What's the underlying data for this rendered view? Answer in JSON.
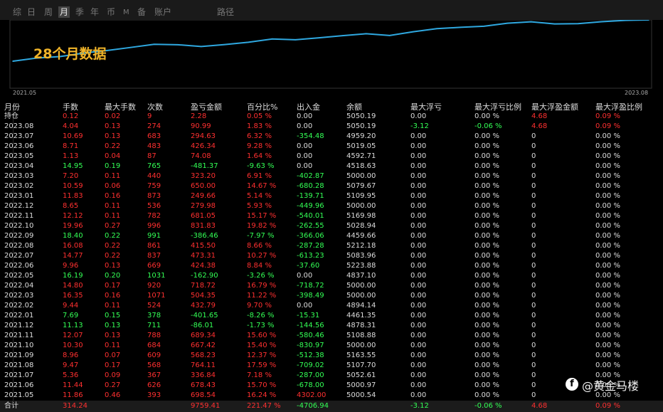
{
  "tabs": [
    {
      "label": "综",
      "active": false
    },
    {
      "label": "日",
      "active": false
    },
    {
      "label": "周",
      "active": false
    },
    {
      "label": "月",
      "active": true
    },
    {
      "label": "季",
      "active": false
    },
    {
      "label": "年",
      "active": false
    },
    {
      "label": "币",
      "active": false
    },
    {
      "label": "M",
      "active": false
    },
    {
      "label": "备",
      "active": false
    },
    {
      "label": "账户",
      "active": false
    },
    {
      "label": "路径",
      "active": false
    }
  ],
  "chart": {
    "title": "28个月数据",
    "x_start": "2021.05",
    "x_end": "2023.08"
  },
  "chart_data": {
    "type": "line",
    "title": "28个月数据",
    "x": [
      "2021.05",
      "2021.06",
      "2021.07",
      "2021.08",
      "2021.09",
      "2021.10",
      "2021.11",
      "2021.12",
      "2022.01",
      "2022.02",
      "2022.03",
      "2022.04",
      "2022.05",
      "2022.06",
      "2022.07",
      "2022.08",
      "2022.09",
      "2022.10",
      "2022.11",
      "2022.12",
      "2023.01",
      "2023.02",
      "2023.03",
      "2023.04",
      "2023.05",
      "2023.06",
      "2023.07",
      "2023.08"
    ],
    "series": [
      {
        "values": [
          698.54,
          1376.97,
          1713.81,
          2478.82,
          3047.05,
          3714.47,
          4403.81,
          4317.8,
          3916.15,
          4348.94,
          4853.29,
          5572.01,
          5409.11,
          5833.49,
          6306.8,
          6722.3,
          6335.84,
          7167.67,
          7848.72,
          8128.7,
          8378.36,
          9028.36,
          9351.56,
          8870.19,
          8944.27,
          9370.61,
          9665.24,
          9756.23
        ]
      }
    ],
    "color": "#2fa8e0"
  },
  "columns": [
    "月份",
    "手数",
    "最大手数",
    "次数",
    "盈亏金额",
    "百分比%",
    "出入金",
    "余额",
    "最大浮亏",
    "最大浮亏比例",
    "最大浮盈金额",
    "最大浮盈比例"
  ],
  "rows": [
    {
      "month": "持仓",
      "lots": "0.12",
      "max_lots": "0.02",
      "count": "9",
      "pnl": "2.28",
      "pct": "0.05 %",
      "flow": "0.00",
      "balance": "5050.19",
      "max_dd": "0.00",
      "max_dd_pct": "0.00 %",
      "max_fp": "4.68",
      "max_fp_pct": "0.09 %",
      "sign": "pos"
    },
    {
      "month": "2023.08",
      "lots": "4.04",
      "max_lots": "0.13",
      "count": "274",
      "pnl": "90.99",
      "pct": "1.83 %",
      "flow": "0.00",
      "balance": "5050.19",
      "max_dd": "-3.12",
      "max_dd_pct": "-0.06 %",
      "max_fp": "4.68",
      "max_fp_pct": "0.09 %",
      "sign": "pos"
    },
    {
      "month": "2023.07",
      "lots": "10.69",
      "max_lots": "0.13",
      "count": "683",
      "pnl": "294.63",
      "pct": "6.32 %",
      "flow": "-354.48",
      "balance": "4959.20",
      "max_dd": "0.00",
      "max_dd_pct": "0.00 %",
      "max_fp": "0",
      "max_fp_pct": "0.00 %",
      "sign": "pos"
    },
    {
      "month": "2023.06",
      "lots": "8.71",
      "max_lots": "0.22",
      "count": "483",
      "pnl": "426.34",
      "pct": "9.28 %",
      "flow": "0.00",
      "balance": "5019.05",
      "max_dd": "0.00",
      "max_dd_pct": "0.00 %",
      "max_fp": "0",
      "max_fp_pct": "0.00 %",
      "sign": "pos"
    },
    {
      "month": "2023.05",
      "lots": "1.13",
      "max_lots": "0.04",
      "count": "87",
      "pnl": "74.08",
      "pct": "1.64 %",
      "flow": "0.00",
      "balance": "4592.71",
      "max_dd": "0.00",
      "max_dd_pct": "0.00 %",
      "max_fp": "0",
      "max_fp_pct": "0.00 %",
      "sign": "pos"
    },
    {
      "month": "2023.04",
      "lots": "14.95",
      "max_lots": "0.19",
      "count": "765",
      "pnl": "-481.37",
      "pct": "-9.63 %",
      "flow": "0.00",
      "balance": "4518.63",
      "max_dd": "0.00",
      "max_dd_pct": "0.00 %",
      "max_fp": "0",
      "max_fp_pct": "0.00 %",
      "sign": "neg"
    },
    {
      "month": "2023.03",
      "lots": "7.20",
      "max_lots": "0.11",
      "count": "440",
      "pnl": "323.20",
      "pct": "6.91 %",
      "flow": "-402.87",
      "balance": "5000.00",
      "max_dd": "0.00",
      "max_dd_pct": "0.00 %",
      "max_fp": "0",
      "max_fp_pct": "0.00 %",
      "sign": "pos"
    },
    {
      "month": "2023.02",
      "lots": "10.59",
      "max_lots": "0.06",
      "count": "759",
      "pnl": "650.00",
      "pct": "14.67 %",
      "flow": "-680.28",
      "balance": "5079.67",
      "max_dd": "0.00",
      "max_dd_pct": "0.00 %",
      "max_fp": "0",
      "max_fp_pct": "0.00 %",
      "sign": "pos"
    },
    {
      "month": "2023.01",
      "lots": "11.83",
      "max_lots": "0.16",
      "count": "873",
      "pnl": "249.66",
      "pct": "5.14 %",
      "flow": "-139.71",
      "balance": "5109.95",
      "max_dd": "0.00",
      "max_dd_pct": "0.00 %",
      "max_fp": "0",
      "max_fp_pct": "0.00 %",
      "sign": "pos"
    },
    {
      "month": "2022.12",
      "lots": "8.65",
      "max_lots": "0.11",
      "count": "536",
      "pnl": "279.98",
      "pct": "5.93 %",
      "flow": "-449.96",
      "balance": "5000.00",
      "max_dd": "0.00",
      "max_dd_pct": "0.00 %",
      "max_fp": "0",
      "max_fp_pct": "0.00 %",
      "sign": "pos"
    },
    {
      "month": "2022.11",
      "lots": "12.12",
      "max_lots": "0.11",
      "count": "782",
      "pnl": "681.05",
      "pct": "15.17 %",
      "flow": "-540.01",
      "balance": "5169.98",
      "max_dd": "0.00",
      "max_dd_pct": "0.00 %",
      "max_fp": "0",
      "max_fp_pct": "0.00 %",
      "sign": "pos"
    },
    {
      "month": "2022.10",
      "lots": "19.96",
      "max_lots": "0.27",
      "count": "996",
      "pnl": "831.83",
      "pct": "19.82 %",
      "flow": "-262.55",
      "balance": "5028.94",
      "max_dd": "0.00",
      "max_dd_pct": "0.00 %",
      "max_fp": "0",
      "max_fp_pct": "0.00 %",
      "sign": "pos"
    },
    {
      "month": "2022.09",
      "lots": "18.40",
      "max_lots": "0.22",
      "count": "991",
      "pnl": "-386.46",
      "pct": "-7.97 %",
      "flow": "-366.06",
      "balance": "4459.66",
      "max_dd": "0.00",
      "max_dd_pct": "0.00 %",
      "max_fp": "0",
      "max_fp_pct": "0.00 %",
      "sign": "neg"
    },
    {
      "month": "2022.08",
      "lots": "16.08",
      "max_lots": "0.22",
      "count": "861",
      "pnl": "415.50",
      "pct": "8.66 %",
      "flow": "-287.28",
      "balance": "5212.18",
      "max_dd": "0.00",
      "max_dd_pct": "0.00 %",
      "max_fp": "0",
      "max_fp_pct": "0.00 %",
      "sign": "pos"
    },
    {
      "month": "2022.07",
      "lots": "14.77",
      "max_lots": "0.22",
      "count": "837",
      "pnl": "473.31",
      "pct": "10.27 %",
      "flow": "-613.23",
      "balance": "5083.96",
      "max_dd": "0.00",
      "max_dd_pct": "0.00 %",
      "max_fp": "0",
      "max_fp_pct": "0.00 %",
      "sign": "pos"
    },
    {
      "month": "2022.06",
      "lots": "9.96",
      "max_lots": "0.13",
      "count": "669",
      "pnl": "424.38",
      "pct": "8.84 %",
      "flow": "-37.60",
      "balance": "5223.88",
      "max_dd": "0.00",
      "max_dd_pct": "0.00 %",
      "max_fp": "0",
      "max_fp_pct": "0.00 %",
      "sign": "pos"
    },
    {
      "month": "2022.05",
      "lots": "16.19",
      "max_lots": "0.20",
      "count": "1031",
      "pnl": "-162.90",
      "pct": "-3.26 %",
      "flow": "0.00",
      "balance": "4837.10",
      "max_dd": "0.00",
      "max_dd_pct": "0.00 %",
      "max_fp": "0",
      "max_fp_pct": "0.00 %",
      "sign": "neg"
    },
    {
      "month": "2022.04",
      "lots": "14.80",
      "max_lots": "0.17",
      "count": "920",
      "pnl": "718.72",
      "pct": "16.79 %",
      "flow": "-718.72",
      "balance": "5000.00",
      "max_dd": "0.00",
      "max_dd_pct": "0.00 %",
      "max_fp": "0",
      "max_fp_pct": "0.00 %",
      "sign": "pos"
    },
    {
      "month": "2022.03",
      "lots": "16.35",
      "max_lots": "0.16",
      "count": "1071",
      "pnl": "504.35",
      "pct": "11.22 %",
      "flow": "-398.49",
      "balance": "5000.00",
      "max_dd": "0.00",
      "max_dd_pct": "0.00 %",
      "max_fp": "0",
      "max_fp_pct": "0.00 %",
      "sign": "pos"
    },
    {
      "month": "2022.02",
      "lots": "9.44",
      "max_lots": "0.11",
      "count": "524",
      "pnl": "432.79",
      "pct": "9.70 %",
      "flow": "0.00",
      "balance": "4894.14",
      "max_dd": "0.00",
      "max_dd_pct": "0.00 %",
      "max_fp": "0",
      "max_fp_pct": "0.00 %",
      "sign": "pos"
    },
    {
      "month": "2022.01",
      "lots": "7.69",
      "max_lots": "0.15",
      "count": "378",
      "pnl": "-401.65",
      "pct": "-8.26 %",
      "flow": "-15.31",
      "balance": "4461.35",
      "max_dd": "0.00",
      "max_dd_pct": "0.00 %",
      "max_fp": "0",
      "max_fp_pct": "0.00 %",
      "sign": "neg"
    },
    {
      "month": "2021.12",
      "lots": "11.13",
      "max_lots": "0.13",
      "count": "711",
      "pnl": "-86.01",
      "pct": "-1.73 %",
      "flow": "-144.56",
      "balance": "4878.31",
      "max_dd": "0.00",
      "max_dd_pct": "0.00 %",
      "max_fp": "0",
      "max_fp_pct": "0.00 %",
      "sign": "neg"
    },
    {
      "month": "2021.11",
      "lots": "12.07",
      "max_lots": "0.13",
      "count": "788",
      "pnl": "689.34",
      "pct": "15.60 %",
      "flow": "-580.46",
      "balance": "5108.88",
      "max_dd": "0.00",
      "max_dd_pct": "0.00 %",
      "max_fp": "0",
      "max_fp_pct": "0.00 %",
      "sign": "pos"
    },
    {
      "month": "2021.10",
      "lots": "10.30",
      "max_lots": "0.11",
      "count": "684",
      "pnl": "667.42",
      "pct": "15.40 %",
      "flow": "-830.97",
      "balance": "5000.00",
      "max_dd": "0.00",
      "max_dd_pct": "0.00 %",
      "max_fp": "0",
      "max_fp_pct": "0.00 %",
      "sign": "pos"
    },
    {
      "month": "2021.09",
      "lots": "8.96",
      "max_lots": "0.07",
      "count": "609",
      "pnl": "568.23",
      "pct": "12.37 %",
      "flow": "-512.38",
      "balance": "5163.55",
      "max_dd": "0.00",
      "max_dd_pct": "0.00 %",
      "max_fp": "0",
      "max_fp_pct": "0.00 %",
      "sign": "pos"
    },
    {
      "month": "2021.08",
      "lots": "9.47",
      "max_lots": "0.17",
      "count": "568",
      "pnl": "764.11",
      "pct": "17.59 %",
      "flow": "-709.02",
      "balance": "5107.70",
      "max_dd": "0.00",
      "max_dd_pct": "0.00 %",
      "max_fp": "0",
      "max_fp_pct": "0.00 %",
      "sign": "pos"
    },
    {
      "month": "2021.07",
      "lots": "5.36",
      "max_lots": "0.09",
      "count": "367",
      "pnl": "336.84",
      "pct": "7.18 %",
      "flow": "-287.00",
      "balance": "5052.61",
      "max_dd": "0.00",
      "max_dd_pct": "0.00 %",
      "max_fp": "0",
      "max_fp_pct": "0.00 %",
      "sign": "pos"
    },
    {
      "month": "2021.06",
      "lots": "11.44",
      "max_lots": "0.27",
      "count": "626",
      "pnl": "678.43",
      "pct": "15.70 %",
      "flow": "-678.00",
      "balance": "5000.97",
      "max_dd": "0.00",
      "max_dd_pct": "0.00 %",
      "max_fp": "0",
      "max_fp_pct": "0.00 %",
      "sign": "pos"
    },
    {
      "month": "2021.05",
      "lots": "11.86",
      "max_lots": "0.46",
      "count": "393",
      "pnl": "698.54",
      "pct": "16.24 %",
      "flow": "4302.00",
      "balance": "5000.54",
      "max_dd": "0.00",
      "max_dd_pct": "0.00 %",
      "max_fp": "0",
      "max_fp_pct": "0.00 %",
      "sign": "pos"
    }
  ],
  "total": {
    "month": "合计",
    "lots": "314.24",
    "pnl": "9759.41",
    "pct": "221.47 %",
    "flow": "-4706.94",
    "max_dd": "-3.12",
    "max_dd_pct": "-0.06 %",
    "max_fp": "4.68",
    "max_fp_pct": "0.09 %"
  },
  "watermark": {
    "text": "@黄金马楼",
    "icon": "facebook-f-icon"
  }
}
